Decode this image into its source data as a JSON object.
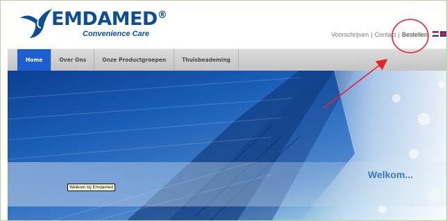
{
  "header": {
    "brand_name": "EMDAMED",
    "brand_symbol": "®",
    "tagline": "Convenience Care",
    "logo_icon": "dove-logo-icon",
    "brand_color": "#0b4e9c"
  },
  "toplinks": {
    "items": [
      {
        "label": "Voorschrijven"
      },
      {
        "label": "Contact"
      },
      {
        "label": "Bestellen"
      }
    ],
    "separator": "|",
    "flags": [
      "nl-flag-icon",
      "uk-flag-icon"
    ]
  },
  "nav": {
    "items": [
      {
        "label": "Home",
        "active": true
      },
      {
        "label": "Over Ons"
      },
      {
        "label": "Onze Productgroepen"
      },
      {
        "label": "Thuisbeademing"
      }
    ],
    "active_color": "#1d5fd0"
  },
  "hero": {
    "welcome_text": "Welkom...",
    "tooltip_text": "Welkom bij Emdamed",
    "image_icon": "waterfall-image"
  },
  "annotation": {
    "circle_color": "#e8202a",
    "arrow_color": "#e8202a"
  }
}
